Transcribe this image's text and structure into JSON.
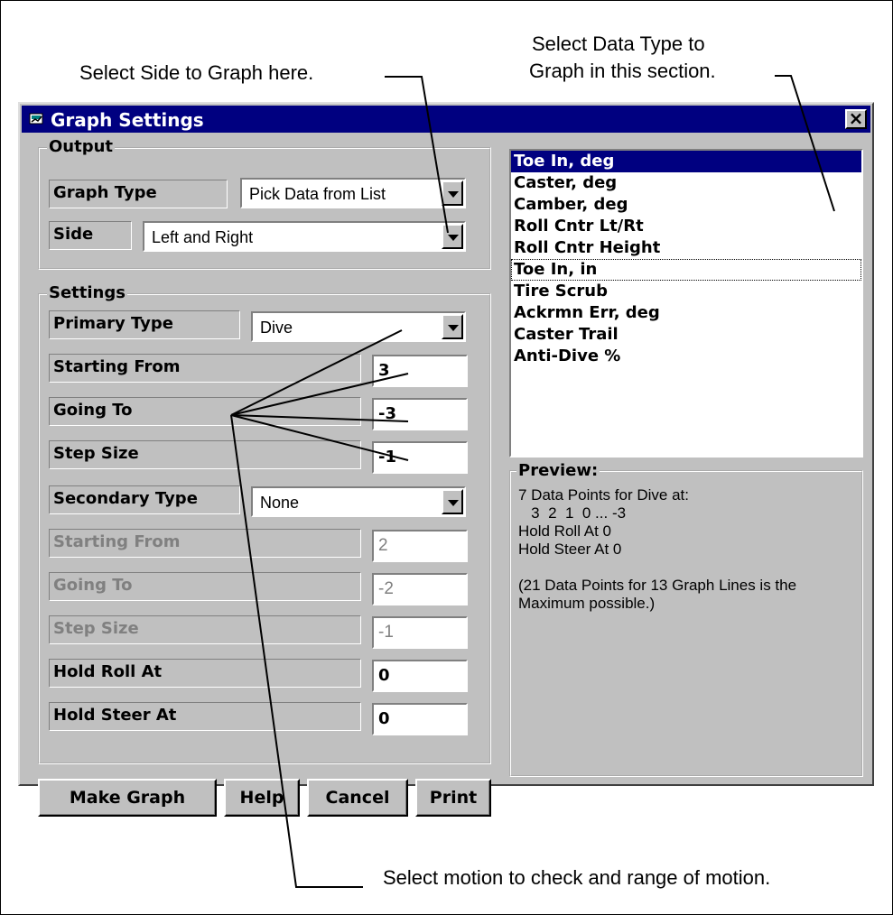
{
  "callouts": {
    "side": "Select Side to Graph here.",
    "data_type_line1": "Select Data Type to",
    "data_type_line2": "Graph in this section.",
    "motion": "Select motion to check and range of motion."
  },
  "window": {
    "title": "Graph Settings",
    "close_label": "×"
  },
  "output": {
    "group_label": "Output",
    "graph_type_label": "Graph Type",
    "graph_type_value": "Pick Data from List",
    "side_label": "Side",
    "side_value": "Left and Right"
  },
  "settings": {
    "group_label": "Settings",
    "primary_type_label": "Primary Type",
    "primary_type_value": "Dive",
    "starting_from_label": "Starting From",
    "starting_from_value": "3",
    "going_to_label": "Going To",
    "going_to_value": "-3",
    "step_size_label": "Step Size",
    "step_size_value": "-1",
    "secondary_type_label": "Secondary Type",
    "secondary_type_value": "None",
    "sec_starting_from_label": "Starting From",
    "sec_starting_from_value": "2",
    "sec_going_to_label": "Going To",
    "sec_going_to_value": "-2",
    "sec_step_size_label": "Step Size",
    "sec_step_size_value": "-1",
    "hold_roll_label": "Hold Roll At",
    "hold_roll_value": "0",
    "hold_steer_label": "Hold Steer At",
    "hold_steer_value": "0"
  },
  "buttons": {
    "make_graph": "Make Graph",
    "help": "Help",
    "cancel": "Cancel",
    "print": "Print"
  },
  "data_list": {
    "items": [
      "Toe In, deg",
      "Caster, deg",
      "Camber, deg",
      "Roll Cntr Lt/Rt",
      "Roll Cntr Height",
      "Toe In, in",
      "Tire Scrub",
      "Ackrmn Err, deg",
      "Caster Trail",
      "Anti-Dive %"
    ],
    "selected_index": 0,
    "focused_index": 5
  },
  "preview": {
    "label": "Preview:",
    "text": "7 Data Points for Dive at:\n   3  2  1  0 ... -3\nHold Roll At 0\nHold Steer At 0\n\n(21 Data Points for 13 Graph Lines is the Maximum possible.)"
  },
  "colors": {
    "titlebar": "#000080",
    "face": "#c0c0c0",
    "selection": "#000080"
  }
}
